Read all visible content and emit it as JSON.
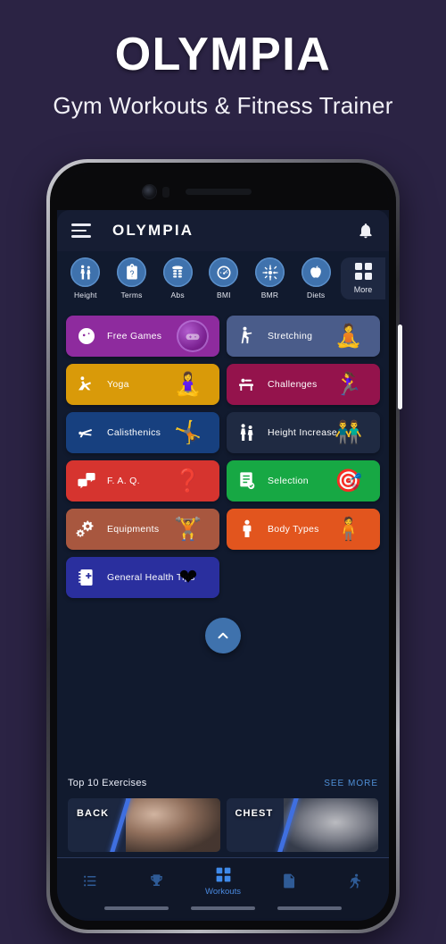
{
  "promo": {
    "title": "OLYMPIA",
    "subtitle": "Gym Workouts & Fitness Trainer"
  },
  "colors": {
    "page_background": "#2b2344",
    "app_background": "#111a2e",
    "appbar": "#161d33",
    "accent_blue": "#3f72ad",
    "link_blue": "#4f8fd6",
    "nav_active": "#3f8aea"
  },
  "appbar": {
    "menu_icon": "hamburger-menu-icon",
    "title": "OLYMPIA",
    "notification_icon": "bell-icon"
  },
  "quick_actions": [
    {
      "label": "Height",
      "icon": "two-people-height-icon"
    },
    {
      "label": "Terms",
      "icon": "clipboard-document-icon"
    },
    {
      "label": "Abs",
      "icon": "abs-muscle-icon"
    },
    {
      "label": "BMI",
      "icon": "speedometer-gauge-icon"
    },
    {
      "label": "BMR",
      "icon": "metabolism-wheel-icon"
    },
    {
      "label": "Diets",
      "icon": "apple-diet-icon"
    }
  ],
  "more_button": {
    "label": "More",
    "icon": "grid-四-squares-icon"
  },
  "cards": [
    {
      "label": "Free Games",
      "color": "#8e2b9e",
      "icon": "gamepad-circle-icon",
      "art": "gamepad-orb"
    },
    {
      "label": "Stretching",
      "color": "#4a5c8a",
      "icon": "standing-stretch-figure-icon",
      "art": "🧘"
    },
    {
      "label": "Yoga",
      "color": "#d99a09",
      "icon": "yoga-pose-figure-icon",
      "art": "🧘‍♀️"
    },
    {
      "label": "Challenges",
      "color": "#94134c",
      "icon": "bench-press-icon",
      "art": "🏃‍♀️"
    },
    {
      "label": "Calisthenics",
      "color": "#17407f",
      "icon": "plank-figure-icon",
      "art": "🤸"
    },
    {
      "label": "Height Increase",
      "color": "#1f2a42",
      "icon": "two-people-height-icon",
      "art": "👬"
    },
    {
      "label": "F. A. Q.",
      "color": "#d6342f",
      "icon": "question-answer-bubbles-icon",
      "art": "❓"
    },
    {
      "label": "Selection",
      "color": "#17a844",
      "icon": "checklist-document-icon",
      "art": "🎯"
    },
    {
      "label": "Equipments",
      "color": "#a8573f",
      "icon": "gears-cog-icon",
      "art": "🏋"
    },
    {
      "label": "Body Types",
      "color": "#e2551e",
      "icon": "person-body-icon",
      "art": "🧍"
    },
    {
      "label": "General Health Tips",
      "color": "#2a2f9e",
      "icon": "medical-notebook-icon",
      "art": "❤"
    }
  ],
  "scroll_top_button": {
    "icon": "chevron-up-icon"
  },
  "top10": {
    "title": "Top 10 Exercises",
    "see_more": "SEE MORE",
    "exercises": [
      {
        "label": "BACK"
      },
      {
        "label": "CHEST"
      }
    ]
  },
  "bottom_nav": [
    {
      "label": "",
      "icon": "list-lines-icon",
      "active": false
    },
    {
      "label": "",
      "icon": "trophy-icon",
      "active": false
    },
    {
      "label": "Workouts",
      "icon": "grid-squares-icon",
      "active": true
    },
    {
      "label": "",
      "icon": "document-text-icon",
      "active": false
    },
    {
      "label": "",
      "icon": "walking-person-icon",
      "active": false
    }
  ]
}
